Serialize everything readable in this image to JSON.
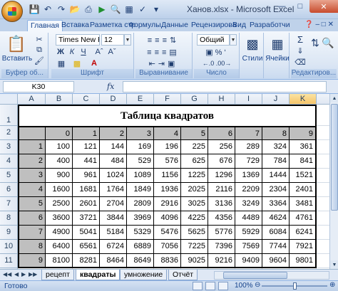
{
  "window": {
    "title": "Ханов.xlsx - Microsoft Excel",
    "minimize": "—",
    "maximize": "□",
    "close": "✕"
  },
  "qat": [
    "save-icon",
    "undo-icon",
    "redo-icon",
    "open-icon",
    "print-icon",
    "run-icon",
    "preview-icon",
    "chart-icon",
    "spelling-icon",
    "dropdown-icon"
  ],
  "ribbon": {
    "tabs": [
      "Главная",
      "Вставка",
      "Разметка стр",
      "Формулы",
      "Данные",
      "Рецензирова",
      "Вид",
      "Разработчик"
    ],
    "active_tab": "Главная",
    "paste_label": "Вставить",
    "font_name": "Times New R",
    "font_size": "12",
    "number_format": "Общий",
    "styles_label": "Стили",
    "cells_label": "Ячейки",
    "groups": {
      "clipboard": "Буфер об...",
      "font": "Шрифт",
      "alignment": "Выравнивание",
      "number": "Число",
      "editing": "Редактиров..."
    },
    "bold": "Ж",
    "italic": "К",
    "underline": "Ч"
  },
  "formula_bar": {
    "name_box": "K30",
    "fx": "fx",
    "value": ""
  },
  "grid": {
    "columns": [
      "A",
      "B",
      "C",
      "D",
      "E",
      "F",
      "G",
      "H",
      "I",
      "J",
      "K"
    ],
    "selected_column": "K",
    "rows": [
      "1",
      "2",
      "3",
      "4",
      "5",
      "6",
      "7",
      "8",
      "9",
      "10",
      "11"
    ]
  },
  "table": {
    "title": "Таблица квадратов",
    "header_row": [
      "",
      "0",
      "1",
      "2",
      "3",
      "4",
      "5",
      "6",
      "7",
      "8",
      "9"
    ],
    "data": [
      [
        "1",
        "100",
        "121",
        "144",
        "169",
        "196",
        "225",
        "256",
        "289",
        "324",
        "361"
      ],
      [
        "2",
        "400",
        "441",
        "484",
        "529",
        "576",
        "625",
        "676",
        "729",
        "784",
        "841"
      ],
      [
        "3",
        "900",
        "961",
        "1024",
        "1089",
        "1156",
        "1225",
        "1296",
        "1369",
        "1444",
        "1521"
      ],
      [
        "4",
        "1600",
        "1681",
        "1764",
        "1849",
        "1936",
        "2025",
        "2116",
        "2209",
        "2304",
        "2401"
      ],
      [
        "5",
        "2500",
        "2601",
        "2704",
        "2809",
        "2916",
        "3025",
        "3136",
        "3249",
        "3364",
        "3481"
      ],
      [
        "6",
        "3600",
        "3721",
        "3844",
        "3969",
        "4096",
        "4225",
        "4356",
        "4489",
        "4624",
        "4761"
      ],
      [
        "7",
        "4900",
        "5041",
        "5184",
        "5329",
        "5476",
        "5625",
        "5776",
        "5929",
        "6084",
        "6241"
      ],
      [
        "8",
        "6400",
        "6561",
        "6724",
        "6889",
        "7056",
        "7225",
        "7396",
        "7569",
        "7744",
        "7921"
      ],
      [
        "9",
        "8100",
        "8281",
        "8464",
        "8649",
        "8836",
        "9025",
        "9216",
        "9409",
        "9604",
        "9801"
      ]
    ]
  },
  "sheets": {
    "tabs": [
      "рецепт",
      "квадраты",
      "умножение",
      "Отчёт"
    ],
    "active": "квадраты"
  },
  "status": {
    "text": "Готово",
    "zoom": "100%",
    "zoom_minus": "⊖",
    "zoom_plus": "⊕"
  }
}
